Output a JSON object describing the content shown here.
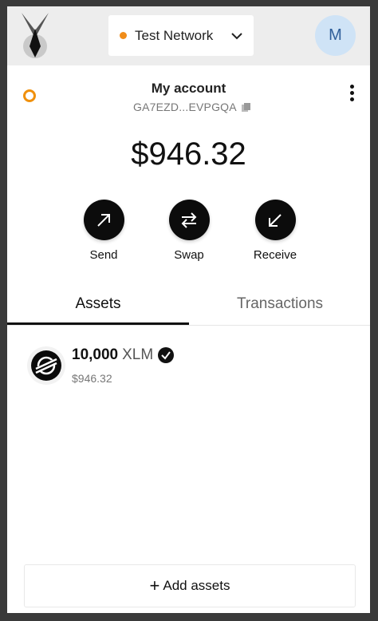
{
  "header": {
    "network_label": "Test Network",
    "avatar_initial": "M",
    "network_dot_color": "#f08c19"
  },
  "account": {
    "name": "My account",
    "address": "GA7EZD...EVPGQA",
    "status_color": "#f0900c"
  },
  "balance": "$946.32",
  "actions": [
    {
      "label": "Send",
      "icon": "arrow-up-right-icon"
    },
    {
      "label": "Swap",
      "icon": "swap-arrows-icon"
    },
    {
      "label": "Receive",
      "icon": "arrow-down-left-icon"
    }
  ],
  "tabs": [
    {
      "label": "Assets",
      "active": true
    },
    {
      "label": "Transactions",
      "active": false
    }
  ],
  "assets": [
    {
      "amount": "10,000",
      "code": "XLM",
      "value": "$946.32",
      "verified": true,
      "icon": "stellar-logo-icon"
    }
  ],
  "add_assets_label": "Add assets"
}
